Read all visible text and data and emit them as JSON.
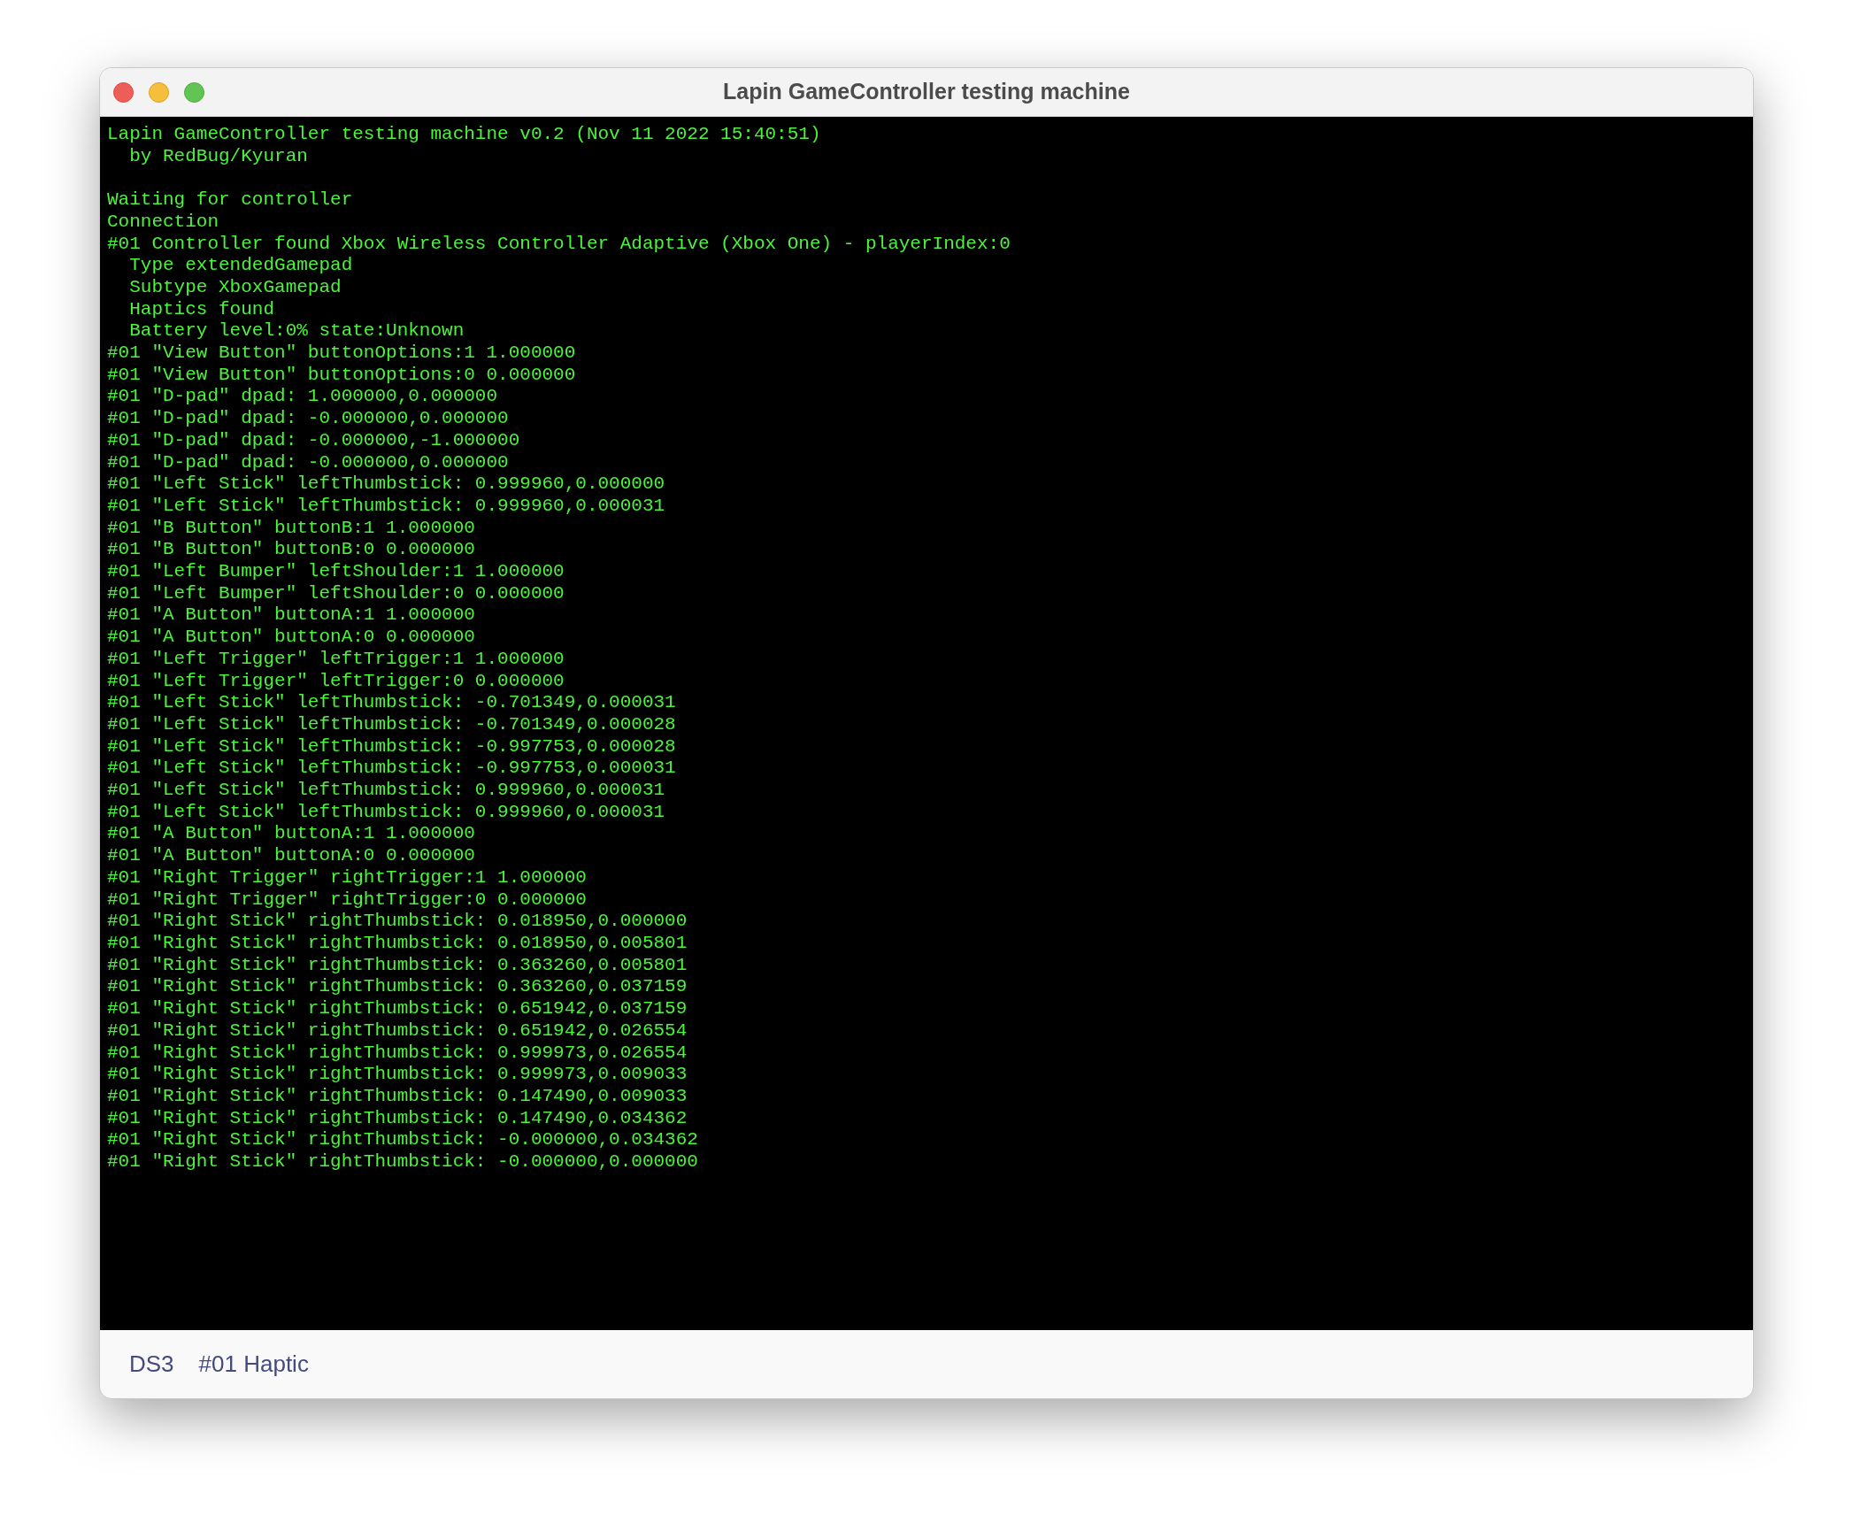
{
  "window": {
    "title": "Lapin GameController testing machine"
  },
  "console": {
    "banner": [
      "Lapin GameController testing machine v0.2 (Nov 11 2022 15:40:51)",
      "  by RedBug/Kyuran"
    ],
    "log": [
      "Waiting for controller",
      "Connection",
      "#01 Controller found Xbox Wireless Controller Adaptive (Xbox One) - playerIndex:0",
      "  Type extendedGamepad",
      "  Subtype XboxGamepad",
      "  Haptics found",
      "  Battery level:0% state:Unknown",
      "#01 \"View Button\" buttonOptions:1 1.000000",
      "#01 \"View Button\" buttonOptions:0 0.000000",
      "#01 \"D-pad\" dpad: 1.000000,0.000000",
      "#01 \"D-pad\" dpad: -0.000000,0.000000",
      "#01 \"D-pad\" dpad: -0.000000,-1.000000",
      "#01 \"D-pad\" dpad: -0.000000,0.000000",
      "#01 \"Left Stick\" leftThumbstick: 0.999960,0.000000",
      "#01 \"Left Stick\" leftThumbstick: 0.999960,0.000031",
      "#01 \"B Button\" buttonB:1 1.000000",
      "#01 \"B Button\" buttonB:0 0.000000",
      "#01 \"Left Bumper\" leftShoulder:1 1.000000",
      "#01 \"Left Bumper\" leftShoulder:0 0.000000",
      "#01 \"A Button\" buttonA:1 1.000000",
      "#01 \"A Button\" buttonA:0 0.000000",
      "#01 \"Left Trigger\" leftTrigger:1 1.000000",
      "#01 \"Left Trigger\" leftTrigger:0 0.000000",
      "#01 \"Left Stick\" leftThumbstick: -0.701349,0.000031",
      "#01 \"Left Stick\" leftThumbstick: -0.701349,0.000028",
      "#01 \"Left Stick\" leftThumbstick: -0.997753,0.000028",
      "#01 \"Left Stick\" leftThumbstick: -0.997753,0.000031",
      "#01 \"Left Stick\" leftThumbstick: 0.999960,0.000031",
      "#01 \"Left Stick\" leftThumbstick: 0.999960,0.000031",
      "#01 \"A Button\" buttonA:1 1.000000",
      "#01 \"A Button\" buttonA:0 0.000000",
      "#01 \"Right Trigger\" rightTrigger:1 1.000000",
      "#01 \"Right Trigger\" rightTrigger:0 0.000000",
      "#01 \"Right Stick\" rightThumbstick: 0.018950,0.000000",
      "#01 \"Right Stick\" rightThumbstick: 0.018950,0.005801",
      "#01 \"Right Stick\" rightThumbstick: 0.363260,0.005801",
      "#01 \"Right Stick\" rightThumbstick: 0.363260,0.037159",
      "#01 \"Right Stick\" rightThumbstick: 0.651942,0.037159",
      "#01 \"Right Stick\" rightThumbstick: 0.651942,0.026554",
      "#01 \"Right Stick\" rightThumbstick: 0.999973,0.026554",
      "#01 \"Right Stick\" rightThumbstick: 0.999973,0.009033",
      "#01 \"Right Stick\" rightThumbstick: 0.147490,0.009033",
      "#01 \"Right Stick\" rightThumbstick: 0.147490,0.034362",
      "#01 \"Right Stick\" rightThumbstick: -0.000000,0.034362",
      "#01 \"Right Stick\" rightThumbstick: -0.000000,0.000000"
    ]
  },
  "footer": {
    "buttons": [
      "DS3",
      "#01 Haptic"
    ]
  }
}
